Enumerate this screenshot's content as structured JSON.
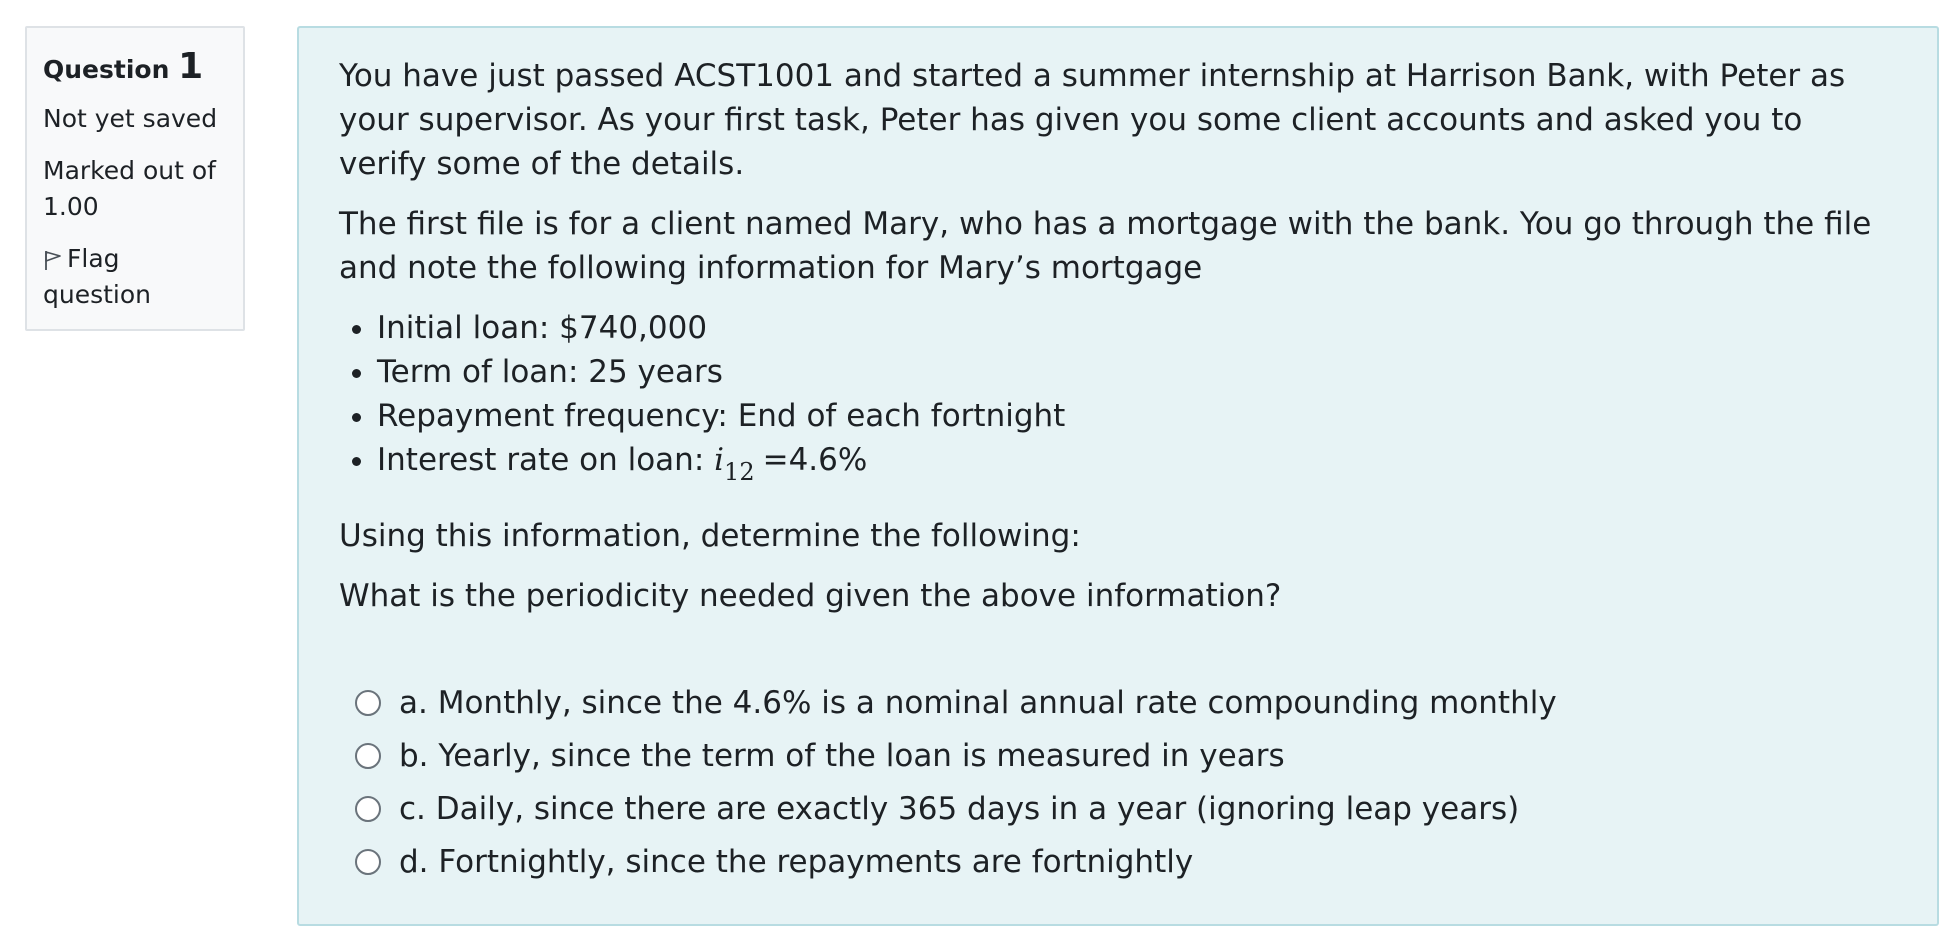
{
  "question_info": {
    "label": "Question",
    "number": "1",
    "status": "Not yet saved",
    "marks_line1": "Marked out of",
    "marks_line2": "1.00",
    "flag_line1": "Flag",
    "flag_line2": "question",
    "flag_icon": "flag-icon"
  },
  "question_text": {
    "intro": "You have just passed ACST1001 and started a summer internship at Harrison Bank, with Peter as your supervisor. As your first task, Peter has given you some client accounts and asked you to verify some of the details.",
    "file_note": "The first file is for a client named Mary, who has a mortgage with the bank. You go through the file and note the following information for Mary’s mortgage",
    "facts": [
      "Initial loan: $740,000",
      "Term of loan: 25 years",
      "Repayment frequency: End of each fortnight"
    ],
    "rate_prefix": "Interest rate on loan: ",
    "rate_symbol": "i",
    "rate_subscript": "12",
    "rate_value": "=4.6%",
    "instruction": "Using this information, determine the following:",
    "prompt": "What is the periodicity needed given the above information?"
  },
  "answers": [
    "a. Monthly, since the 4.6% is a nominal annual rate compounding monthly",
    "b. Yearly, since the term of the loan is measured in years",
    "c. Daily, since there are exactly 365 days in a year (ignoring leap years)",
    "d. Fortnightly, since the repayments are fortnightly"
  ],
  "colors": {
    "info_bg": "#f8f9fa",
    "content_bg": "#e7f3f5",
    "content_border": "#b8dce2",
    "text": "#1d2125"
  }
}
